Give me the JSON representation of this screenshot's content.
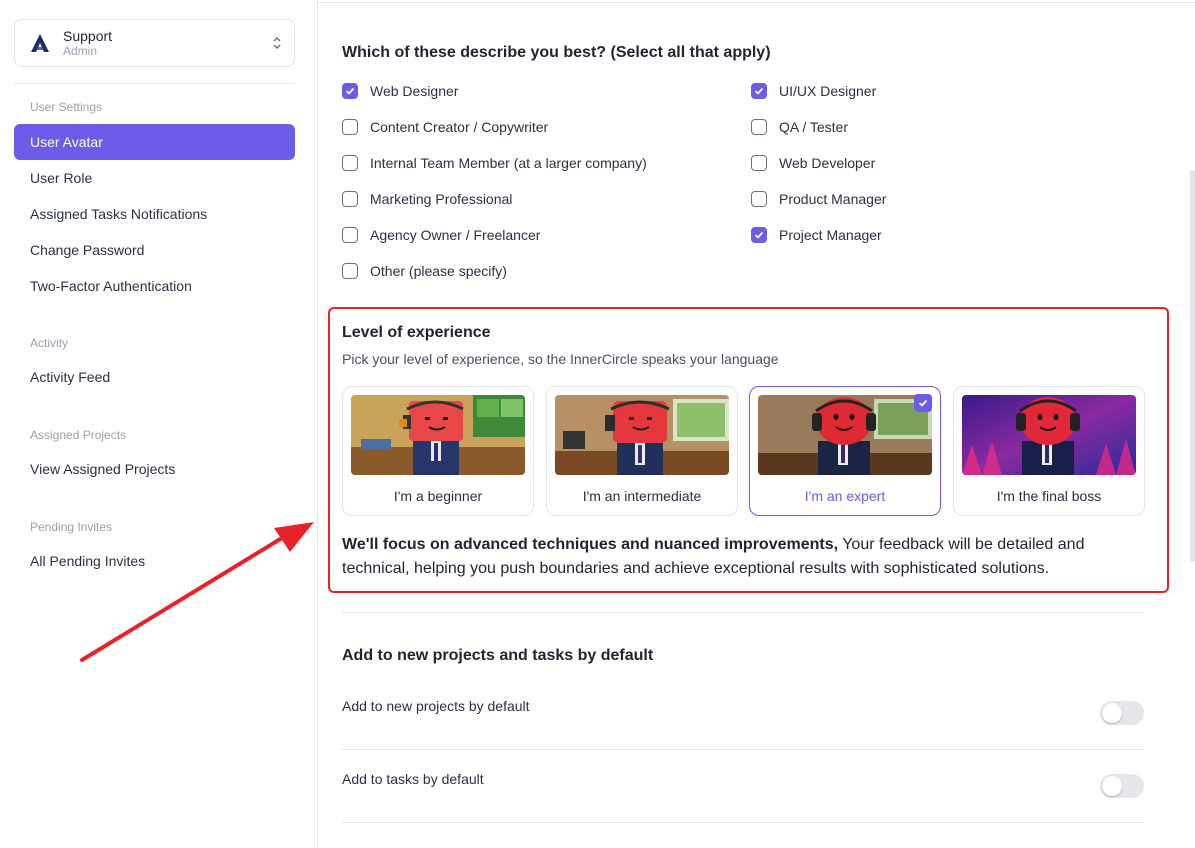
{
  "workspace": {
    "name": "Support",
    "role": "Admin"
  },
  "sidebar": {
    "groups": [
      {
        "heading": "User Settings",
        "items": [
          "User Avatar",
          "User Role",
          "Assigned Tasks Notifications",
          "Change Password",
          "Two-Factor Authentication"
        ]
      },
      {
        "heading": "Activity",
        "items": [
          "Activity Feed"
        ]
      },
      {
        "heading": "Assigned Projects",
        "items": [
          "View Assigned Projects"
        ]
      },
      {
        "heading": "Pending Invites",
        "items": [
          "All Pending Invites"
        ]
      }
    ],
    "active_item": "User Avatar"
  },
  "roles": {
    "title": "Which of these describe you best? (Select all that apply)",
    "left": [
      {
        "label": "Web Designer",
        "checked": true
      },
      {
        "label": "Content Creator / Copywriter",
        "checked": false
      },
      {
        "label": "Internal Team Member (at a larger company)",
        "checked": false
      },
      {
        "label": "Marketing Professional",
        "checked": false
      },
      {
        "label": "Agency Owner / Freelancer",
        "checked": false
      },
      {
        "label": "Other (please specify)",
        "checked": false
      }
    ],
    "right": [
      {
        "label": "UI/UX Designer",
        "checked": true
      },
      {
        "label": "QA / Tester",
        "checked": false
      },
      {
        "label": "Web Developer",
        "checked": false
      },
      {
        "label": "Product Manager",
        "checked": false
      },
      {
        "label": "Project Manager",
        "checked": true
      }
    ]
  },
  "experience": {
    "title": "Level of experience",
    "subtitle": "Pick your level of experience, so the InnerCircle speaks your language",
    "levels": [
      {
        "label": "I'm a beginner",
        "selected": false
      },
      {
        "label": "I'm an intermediate",
        "selected": false
      },
      {
        "label": "I'm an expert",
        "selected": true
      },
      {
        "label": "I'm the final boss",
        "selected": false
      }
    ],
    "description_bold": "We'll focus on advanced techniques and nuanced improvements,",
    "description_rest": " Your feedback will be detailed and technical, helping you push boundaries and achieve exceptional results with sophisticated solutions."
  },
  "defaults": {
    "title": "Add to new projects and tasks by default",
    "toggles": [
      {
        "label": "Add to new projects by default",
        "on": false
      },
      {
        "label": "Add to tasks by default",
        "on": false
      }
    ]
  },
  "colors": {
    "accent": "#6c5ce7",
    "highlight": "#e8222a"
  },
  "icons": {
    "logo": "workspace-logo-icon",
    "chevron": "chevron-updown-icon",
    "check": "check-icon",
    "arrow": "red-arrow-annotation"
  }
}
